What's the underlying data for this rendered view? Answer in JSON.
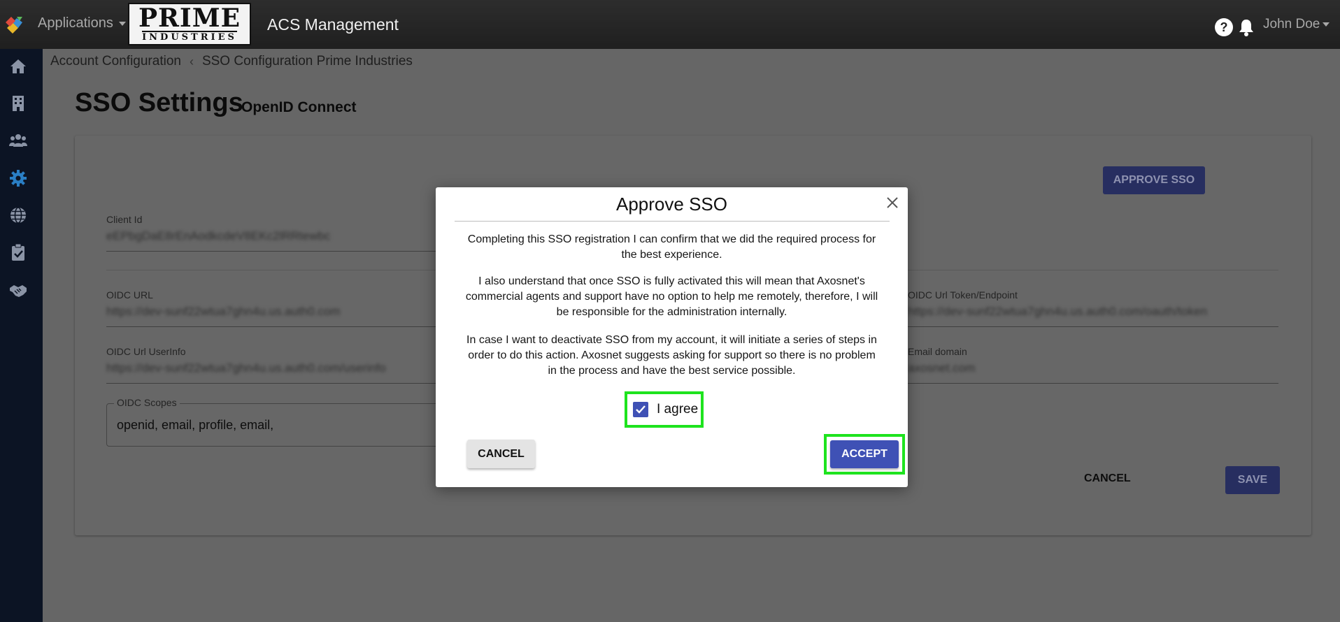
{
  "header": {
    "apps_label": "Applications",
    "brand_top": "PRIME",
    "brand_bottom": "INDUSTRIES",
    "title": "ACS Management",
    "help_glyph": "?",
    "user_name": "John Doe"
  },
  "sidebar": {
    "items": [
      {
        "icon": "home-icon"
      },
      {
        "icon": "building-icon"
      },
      {
        "icon": "users-icon"
      },
      {
        "icon": "gear-icon",
        "active": true
      },
      {
        "icon": "globe-icon"
      },
      {
        "icon": "clipboard-check-icon"
      },
      {
        "icon": "handshake-icon"
      }
    ]
  },
  "breadcrumb": {
    "parent": "Account Configuration",
    "separator": "‹",
    "current": "SSO Configuration Prime Industries"
  },
  "page": {
    "title": "SSO Settings",
    "subtitle": "OpenID Connect",
    "approve_sso_label": "APPROVE SSO",
    "fields": {
      "client_id": {
        "label": "Client Id",
        "value": "eEPbgDaE8rEnAodkcdeV8EKc2lRRtewbc"
      },
      "oidc_url": {
        "label": "OIDC URL",
        "value": "https://dev-sunf22wtua7ghn4u.us.auth0.com"
      },
      "oidc_token": {
        "label": "OIDC Url Token/Endpoint",
        "value": "https://dev-sunf22wtua7ghn4u.us.auth0.com/oauth/token"
      },
      "oidc_userinfo": {
        "label": "OIDC Url UserInfo",
        "value": "https://dev-sunf22wtua7ghn4u.us.auth0.com/userinfo"
      },
      "email_domain": {
        "label": "Email domain",
        "value": "axosnet.com"
      },
      "scopes": {
        "label": "OIDC Scopes",
        "value": "openid, email, profile, email,"
      }
    },
    "cancel_label": "CANCEL",
    "save_label": "SAVE"
  },
  "modal": {
    "title": "Approve SSO",
    "p1": "Completing this SSO registration I can confirm that we did the required process for the best experience.",
    "p2": "I also understand that once SSO is fully activated this will mean that Axosnet's commercial agents and support have no option to help me remotely, therefore, I will be responsible for the administration internally.",
    "p3": "In case I want to deactivate SSO from my account, it will initiate a series of steps in order to do this action. Axosnet suggests asking for support so there is no problem in the process and have the best service possible.",
    "agree_label": "I agree",
    "agree_checked": true,
    "cancel_label": "CANCEL",
    "accept_label": "ACCEPT"
  },
  "colors": {
    "primary": "#3f51b5",
    "highlight": "#1ee31e",
    "sidebar_bg": "#0c1424",
    "active_icon": "#2a7fc5"
  }
}
